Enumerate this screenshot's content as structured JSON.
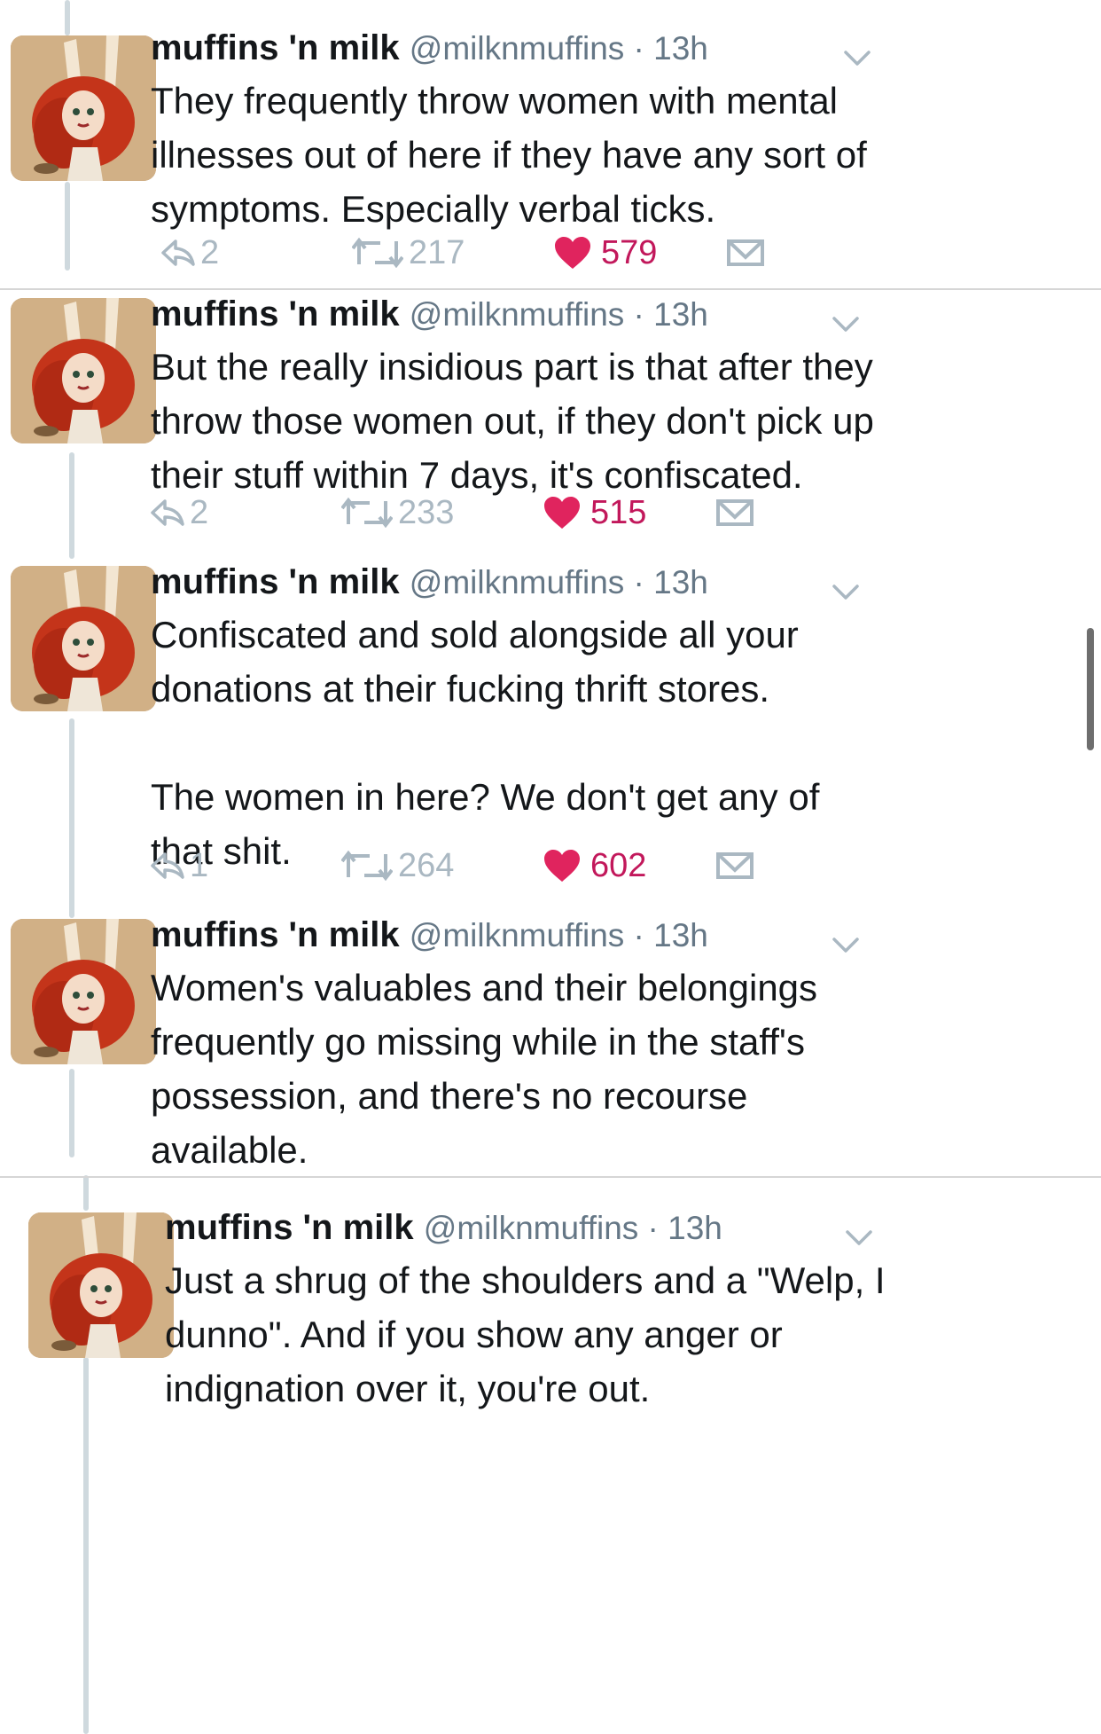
{
  "tweets": [
    {
      "name": "muffins 'n milk",
      "meta": "@milknmuffins · 13h",
      "text": "They frequently throw women with mental\nillnesses out of here if they have any sort of\nsymptoms. Especially verbal ticks.",
      "replies": "2",
      "retweets": "217",
      "likes": "579"
    },
    {
      "name": "muffins 'n milk",
      "meta": "@milknmuffins · 13h",
      "text": "But the really insidious part is that after they\nthrow those women out, if they don't pick up\ntheir stuff within 7 days, it's confiscated.",
      "replies": "2",
      "retweets": "233",
      "likes": "515"
    },
    {
      "name": "muffins 'n milk",
      "meta": "@milknmuffins · 13h",
      "text": "Confiscated and sold alongside all your\ndonations at their fucking thrift stores.\n\nThe women in here? We don't get any of\nthat shit.",
      "replies": "1",
      "retweets": "264",
      "likes": "602"
    },
    {
      "name": "muffins 'n milk",
      "meta": "@milknmuffins · 13h",
      "text": "Women's valuables and their belongings\nfrequently go missing while in the staff's\npossession, and there's no recourse\navailable."
    },
    {
      "name": "muffins 'n milk",
      "meta": "@milknmuffins · 13h",
      "text": "Just a shrug of the shoulders and a \"Welp, I\ndunno\". And if you show any anger or\nindignation over it, you're out."
    }
  ],
  "icons": {
    "reply": "reply-icon",
    "retweet": "retweet-icon",
    "like": "heart-icon",
    "dm": "envelope-icon",
    "menu": "chevron-down-icon"
  },
  "colors": {
    "like": "#e0245e",
    "muted": "#aab8c2",
    "thread_line": "#cfd9de"
  }
}
